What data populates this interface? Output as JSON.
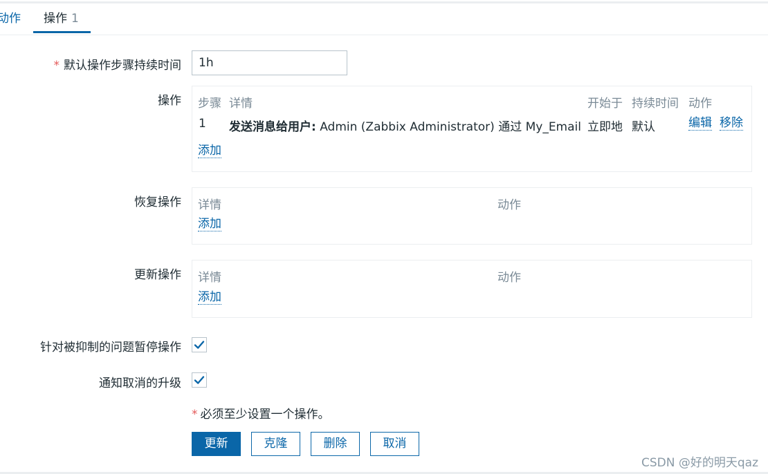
{
  "tabs": [
    {
      "label": "动作"
    },
    {
      "label": "操作",
      "count": "1"
    }
  ],
  "form": {
    "default_step_duration": {
      "required_mark": "*",
      "label": "默认操作步骤持续时间",
      "value": "1h"
    },
    "operations": {
      "label": "操作",
      "headers": {
        "steps": "步骤",
        "details": "详情",
        "start_in": "开始于",
        "duration": "持续时间",
        "action": "动作"
      },
      "rows": [
        {
          "step": "1",
          "details_bold": "发送消息给用户:",
          "details_rest": " Admin (Zabbix Administrator) 通过 My_Email",
          "start_in": "立即地",
          "duration": "默认",
          "edit": "编辑",
          "remove": "移除"
        }
      ],
      "add": "添加"
    },
    "recovery_operations": {
      "label": "恢复操作",
      "headers": {
        "details": "详情",
        "action": "动作"
      },
      "add": "添加"
    },
    "update_operations": {
      "label": "更新操作",
      "headers": {
        "details": "详情",
        "action": "动作"
      },
      "add": "添加"
    },
    "pause_suppressed": {
      "label": "针对被抑制的问题暂停操作",
      "checked": true
    },
    "notify_cancelled": {
      "label": "通知取消的升级",
      "checked": true
    },
    "note": {
      "mark": "*",
      "text": "必须至少设置一个操作。"
    }
  },
  "buttons": {
    "update": "更新",
    "clone": "克隆",
    "delete": "删除",
    "cancel": "取消"
  },
  "watermark": "CSDN @好的明天qaz",
  "colors": {
    "accent": "#0a66a8",
    "required": "#e45959",
    "muted": "#7a8a96",
    "border": "#b8c3cb"
  }
}
